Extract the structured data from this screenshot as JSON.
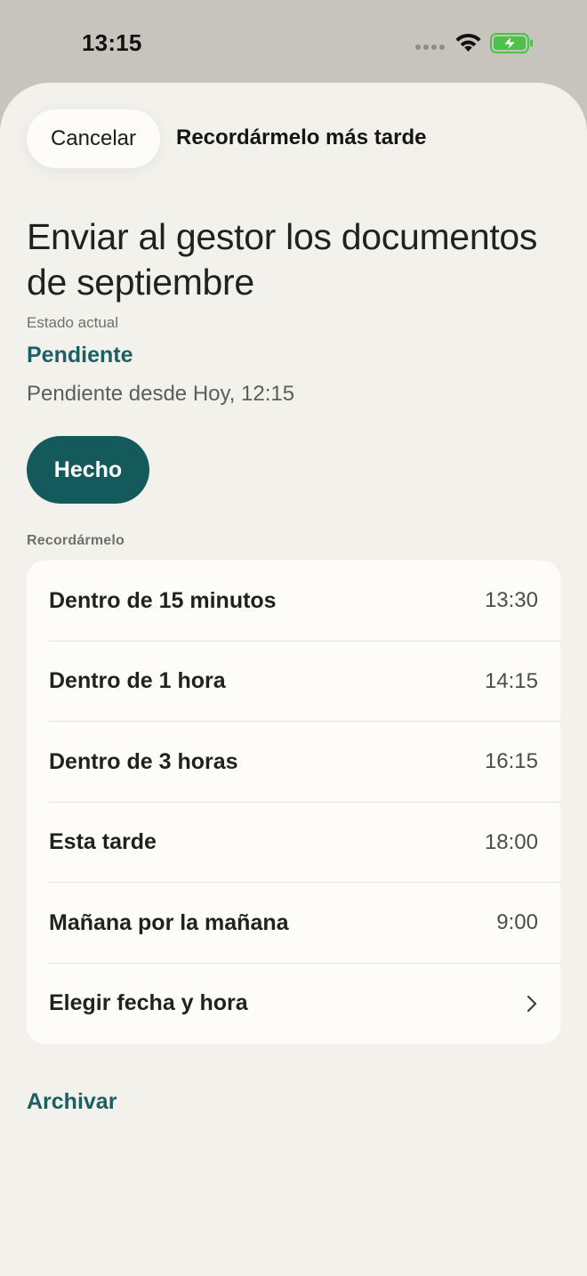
{
  "status_bar": {
    "time": "13:15",
    "icons": [
      "signal-dots-icon",
      "wifi-icon",
      "battery-charging-icon"
    ],
    "battery_color": "#4cc24a"
  },
  "header": {
    "cancel_label": "Cancelar",
    "title": "Recordármelo más tarde"
  },
  "task": {
    "title": "Enviar al gestor los documentos de septiembre",
    "status_label": "Estado actual",
    "status_value": "Pendiente",
    "status_since": "Pendiente desde Hoy, 12:15"
  },
  "actions": {
    "done_label": "Hecho",
    "archive_label": "Archivar"
  },
  "remind": {
    "section_label": "Recordármelo",
    "options": [
      {
        "label": "Dentro de 15 minutos",
        "time": "13:30"
      },
      {
        "label": "Dentro de 1 hora",
        "time": "14:15"
      },
      {
        "label": "Dentro de 3 horas",
        "time": "16:15"
      },
      {
        "label": "Esta tarde",
        "time": "18:00"
      },
      {
        "label": "Mañana por la mañana",
        "time": "9:00"
      },
      {
        "label": "Elegir fecha y hora",
        "icon": "chevron-right-icon"
      }
    ]
  },
  "colors": {
    "accent": "#145a5c",
    "accent_text": "#1a5f62",
    "sheet_background": "#f3f1ec",
    "card_background": "#fdfcf8"
  }
}
